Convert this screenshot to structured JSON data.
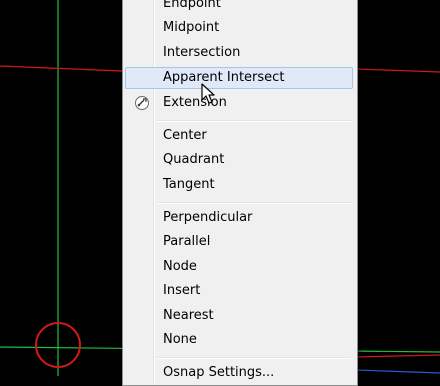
{
  "canvas": {
    "background": "#000000",
    "axis_green": "#1fbf3f",
    "axis_red": "#d01818",
    "osnap_marker": "#d01818"
  },
  "menu": {
    "items": [
      {
        "label": "Endpoint"
      },
      {
        "label": "Midpoint"
      },
      {
        "label": "Intersection"
      },
      {
        "label": "Apparent Intersect",
        "highlighted": true
      },
      {
        "label": "Extension",
        "icon": "extension-snap-icon"
      },
      {
        "label": "Center"
      },
      {
        "label": "Quadrant"
      },
      {
        "label": "Tangent"
      },
      {
        "label": "Perpendicular"
      },
      {
        "label": "Parallel"
      },
      {
        "label": "Node"
      },
      {
        "label": "Insert"
      },
      {
        "label": "Nearest"
      },
      {
        "label": "None"
      },
      {
        "label": "Osnap Settings..."
      }
    ]
  }
}
